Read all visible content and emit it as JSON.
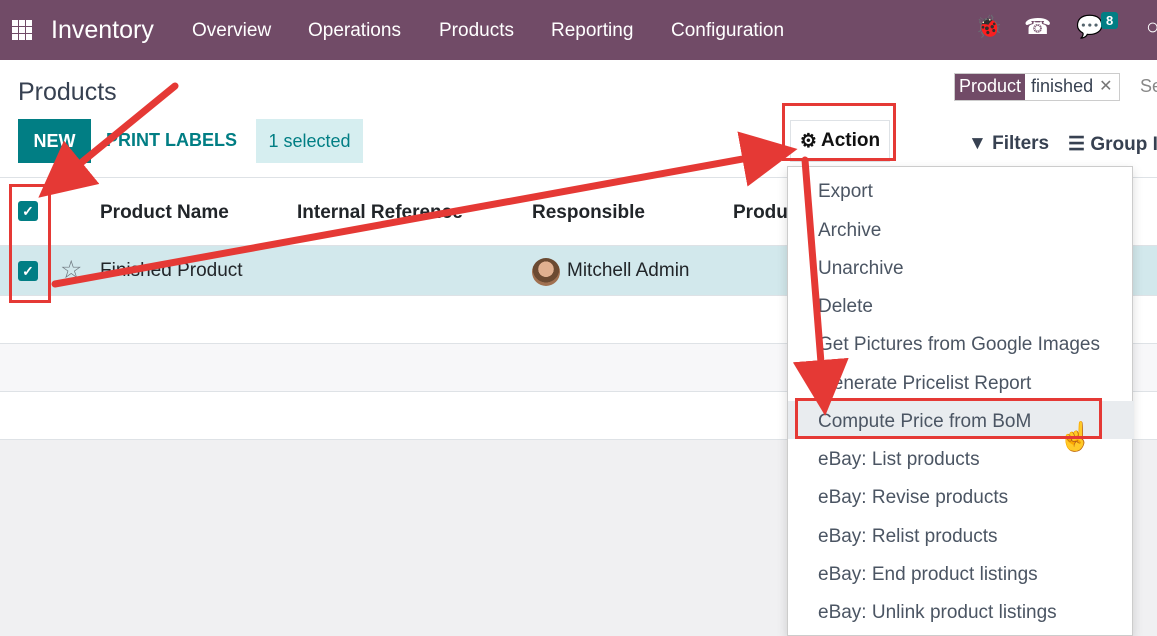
{
  "navbar": {
    "app_name": "Inventory",
    "menu": [
      "Overview",
      "Operations",
      "Products",
      "Reporting",
      "Configuration"
    ],
    "chat_count": "8"
  },
  "page": {
    "title": "Products",
    "new_label": "NEW",
    "print_labels": "PRINT LABELS",
    "selected_label": "1 selected",
    "action_label": "Action"
  },
  "search": {
    "facet_label": "Product",
    "facet_value": "finished",
    "placeholder": "Se",
    "filters_label": "Filters",
    "groupby_label": "Group I"
  },
  "table": {
    "columns": [
      "Product Name",
      "Internal Reference",
      "Responsible",
      "Produ"
    ],
    "rows": [
      {
        "name": "Finished Product",
        "responsible": "Mitchell Admin"
      }
    ]
  },
  "action_menu": {
    "items": [
      "Export",
      "Archive",
      "Unarchive",
      "Delete",
      "Get Pictures from Google Images",
      "Generate Pricelist Report",
      "Compute Price from BoM",
      "eBay: List products",
      "eBay: Revise products",
      "eBay: Relist products",
      "eBay: End product listings",
      "eBay: Unlink product listings"
    ],
    "highlighted": "Compute Price from BoM"
  },
  "colors": {
    "brand": "#714b67",
    "accent": "#017e84",
    "annotation": "#e53935"
  }
}
